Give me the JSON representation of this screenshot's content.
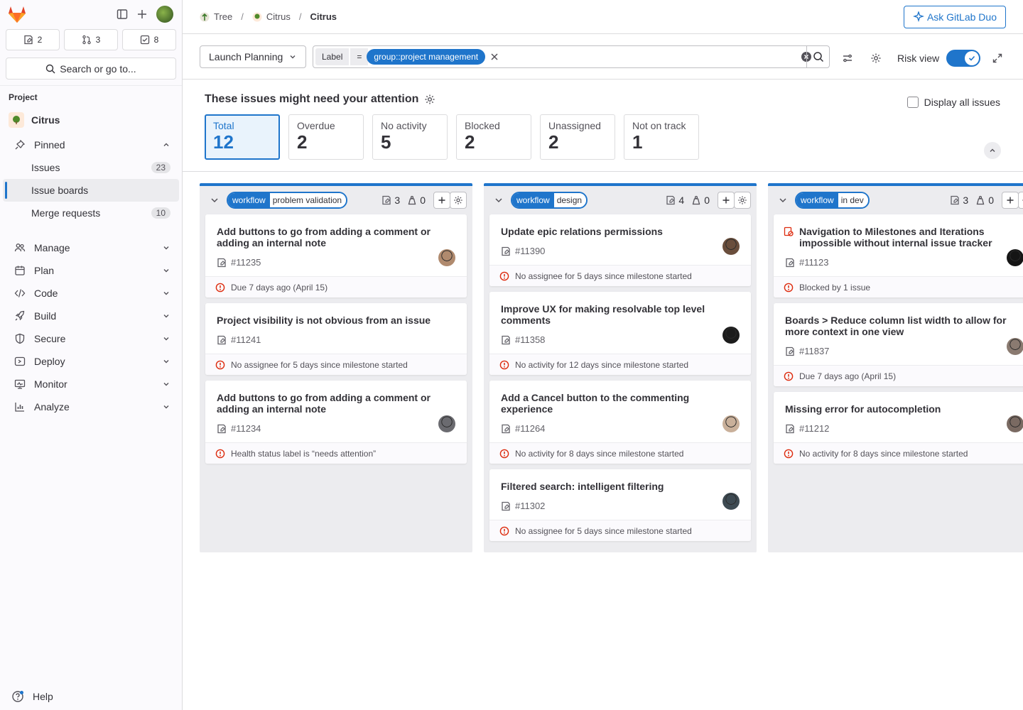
{
  "sidebar": {
    "counts": [
      {
        "icon": "issue-icon",
        "value": "2"
      },
      {
        "icon": "merge-request-icon",
        "value": "3"
      },
      {
        "icon": "todo-icon",
        "value": "8"
      }
    ],
    "search_label": "Search or go to...",
    "section_label": "Project",
    "project_name": "Citrus",
    "pinned_label": "Pinned",
    "pinned_items": [
      {
        "label": "Issues",
        "count": "23"
      },
      {
        "label": "Issue boards",
        "count": ""
      },
      {
        "label": "Merge requests",
        "count": "10"
      }
    ],
    "nav": [
      {
        "label": "Manage",
        "icon": "users-icon"
      },
      {
        "label": "Plan",
        "icon": "calendar-icon"
      },
      {
        "label": "Code",
        "icon": "code-icon"
      },
      {
        "label": "Build",
        "icon": "rocket-icon"
      },
      {
        "label": "Secure",
        "icon": "shield-icon"
      },
      {
        "label": "Deploy",
        "icon": "deploy-icon"
      },
      {
        "label": "Monitor",
        "icon": "monitor-icon"
      },
      {
        "label": "Analyze",
        "icon": "chart-icon"
      }
    ],
    "help_label": "Help"
  },
  "header": {
    "breadcrumbs": [
      "Tree",
      "Citrus",
      "Citrus"
    ],
    "duo_label": "Ask GitLab Duo"
  },
  "filter": {
    "board_name": "Launch Planning",
    "token_name": "Label",
    "token_operator": "=",
    "token_value": "group::project management",
    "risk_view_label": "Risk view",
    "risk_view_on": true
  },
  "attention": {
    "title": "These issues might need your attention",
    "display_all_label": "Display all issues",
    "stats": [
      {
        "label": "Total",
        "value": "12"
      },
      {
        "label": "Overdue",
        "value": "2"
      },
      {
        "label": "No activity",
        "value": "5"
      },
      {
        "label": "Blocked",
        "value": "2"
      },
      {
        "label": "Unassigned",
        "value": "2"
      },
      {
        "label": "Not on track",
        "value": "1"
      }
    ]
  },
  "columns": [
    {
      "label_key": "workflow",
      "label_value": "problem validation",
      "issues": "3",
      "weight": "0",
      "cards": [
        {
          "title": "Add buttons to go from adding a comment or adding an internal note",
          "id": "#11235",
          "foot": "Due 7 days ago (April 15)",
          "avatar": "#b08a6e"
        },
        {
          "title": "Project visibility is not obvious from an issue",
          "id": "#11241",
          "foot": "No assignee for 5 days since milestone started",
          "avatar": ""
        },
        {
          "title": "Add buttons to go from adding a comment or adding an internal note",
          "id": "#11234",
          "foot": "Health status label is “needs attention”",
          "avatar": "#6b6b70"
        }
      ]
    },
    {
      "label_key": "workflow",
      "label_value": "design",
      "issues": "4",
      "weight": "0",
      "cards": [
        {
          "title": "Update epic relations permissions",
          "id": "#11390",
          "foot": "No assignee for 5 days since milestone started",
          "avatar": "#6a4e3c"
        },
        {
          "title": "Improve UX for making resolvable top level comments",
          "id": "#11358",
          "foot": "No activity for 12 days since milestone started",
          "avatar": "#1c1c1c"
        },
        {
          "title": "Add a Cancel button to the commenting experience",
          "id": "#11264",
          "foot": "No activity for 8 days since milestone started",
          "avatar": "#c9b09a"
        },
        {
          "title": "Filtered search: intelligent filtering",
          "id": "#11302",
          "foot": "No assignee for 5 days since milestone started",
          "avatar": "#3d4a52"
        }
      ]
    },
    {
      "label_key": "workflow",
      "label_value": "in dev",
      "issues": "3",
      "weight": "0",
      "cards": [
        {
          "title": "Navigation to Milestones and Iterations impossible without internal issue tracker",
          "id": "#11123",
          "foot": "Blocked by 1 issue",
          "avatar": "#151515",
          "blocked": true
        },
        {
          "title": "Boards > Reduce column list width to allow for more context in one view",
          "id": "#11837",
          "foot": "Due 7 days ago (April 15)",
          "avatar": "#8a7a70"
        },
        {
          "title": "Missing error for autocompletion",
          "id": "#11212",
          "foot": "No activity for 8 days since milestone started",
          "avatar": "#7a6a62"
        }
      ]
    }
  ],
  "colors": {
    "accent": "#1f75cb",
    "danger": "#dd2b0e",
    "brand": "#e24329"
  }
}
